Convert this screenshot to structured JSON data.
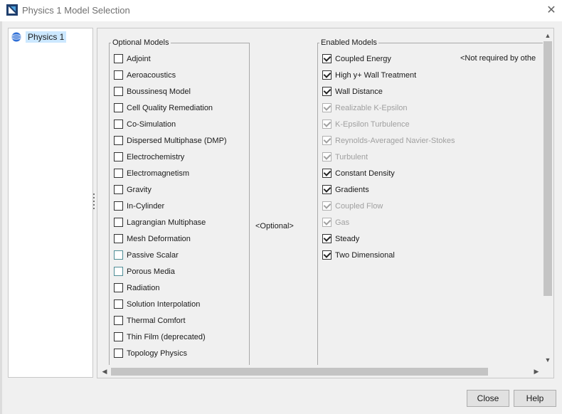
{
  "window": {
    "title": "Physics 1 Model Selection",
    "close_glyph": "✕"
  },
  "tree": {
    "items": [
      {
        "label": "Physics 1",
        "icon": "globe-icon",
        "selected": true
      }
    ]
  },
  "optional_models": {
    "legend": "Optional Models",
    "items": [
      {
        "label": "Adjoint"
      },
      {
        "label": "Aeroacoustics"
      },
      {
        "label": "Boussinesq Model"
      },
      {
        "label": "Cell Quality Remediation"
      },
      {
        "label": "Co-Simulation"
      },
      {
        "label": "Dispersed Multiphase (DMP)"
      },
      {
        "label": "Electrochemistry"
      },
      {
        "label": "Electromagnetism"
      },
      {
        "label": "Gravity"
      },
      {
        "label": "In-Cylinder"
      },
      {
        "label": "Lagrangian Multiphase"
      },
      {
        "label": "Mesh Deformation"
      },
      {
        "label": "Passive Scalar"
      },
      {
        "label": "Porous Media"
      },
      {
        "label": "Radiation"
      },
      {
        "label": "Solution Interpolation"
      },
      {
        "label": "Thermal Comfort"
      },
      {
        "label": "Thin Film (deprecated)"
      },
      {
        "label": "Topology Physics"
      }
    ]
  },
  "middle_status": "<Optional>",
  "enabled_models": {
    "legend": "Enabled Models",
    "note": "<Not required by othe",
    "items": [
      {
        "label": "Coupled Energy",
        "checked": true,
        "disabled": false
      },
      {
        "label": "High y+ Wall Treatment",
        "checked": true,
        "disabled": false
      },
      {
        "label": "Wall Distance",
        "checked": true,
        "disabled": false
      },
      {
        "label": "Realizable K-Epsilon",
        "checked": true,
        "disabled": true
      },
      {
        "label": "K-Epsilon Turbulence",
        "checked": true,
        "disabled": true
      },
      {
        "label": "Reynolds-Averaged Navier-Stokes",
        "checked": true,
        "disabled": true
      },
      {
        "label": "Turbulent",
        "checked": true,
        "disabled": true
      },
      {
        "label": "Constant Density",
        "checked": true,
        "disabled": false
      },
      {
        "label": "Gradients",
        "checked": true,
        "disabled": false
      },
      {
        "label": "Coupled Flow",
        "checked": true,
        "disabled": true
      },
      {
        "label": "Gas",
        "checked": true,
        "disabled": true
      },
      {
        "label": "Steady",
        "checked": true,
        "disabled": false
      },
      {
        "label": "Two Dimensional",
        "checked": true,
        "disabled": false
      }
    ]
  },
  "buttons": {
    "close": "Close",
    "help": "Help"
  }
}
